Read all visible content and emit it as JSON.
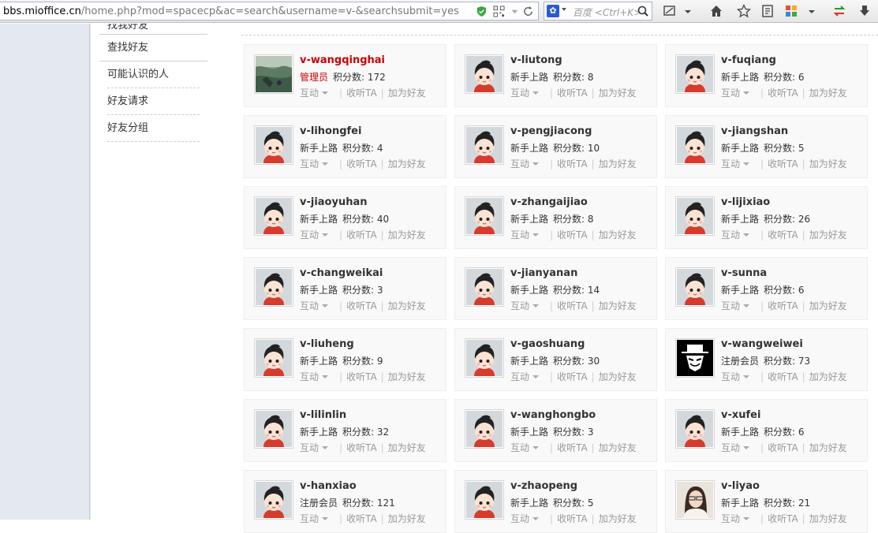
{
  "browser": {
    "url_host": "bbs.mioffice.cn",
    "url_path": "/home.php?mod=spacecp&ac=search&username=v-&searchsubmit=yes",
    "search_placeholder": "百度 <Ctrl+K>",
    "icons": [
      "shield-icon",
      "qr-icon",
      "dropdown-icon",
      "refresh-icon",
      "paw-icon",
      "search-icon",
      "screenshot-icon",
      "home-icon",
      "star-icon",
      "reader-icon",
      "apps-icon",
      "sync-icon",
      "download-icon"
    ]
  },
  "sidebar": {
    "cut_item": "找我好友",
    "active": "查找好友",
    "items": [
      "可能认识的人",
      "好友请求",
      "好友分组"
    ]
  },
  "labels": {
    "points": "积分数:",
    "interact": "互动",
    "follow": "收听TA",
    "add_friend": "加为好友"
  },
  "users": [
    {
      "name": "v-wangqinghai",
      "group": "管理员",
      "points": "172",
      "avatar": "photo-landscape",
      "admin": true
    },
    {
      "name": "v-liutong",
      "group": "新手上路",
      "points": "8",
      "avatar": "default"
    },
    {
      "name": "v-fuqiang",
      "group": "新手上路",
      "points": "6",
      "avatar": "default"
    },
    {
      "name": "v-lihongfei",
      "group": "新手上路",
      "points": "4",
      "avatar": "default"
    },
    {
      "name": "v-pengjiacong",
      "group": "新手上路",
      "points": "10",
      "avatar": "default"
    },
    {
      "name": "v-jiangshan",
      "group": "新手上路",
      "points": "5",
      "avatar": "default"
    },
    {
      "name": "v-jiaoyuhan",
      "group": "新手上路",
      "points": "40",
      "avatar": "default"
    },
    {
      "name": "v-zhangaijiao",
      "group": "新手上路",
      "points": "8",
      "avatar": "default"
    },
    {
      "name": "v-lijixiao",
      "group": "新手上路",
      "points": "26",
      "avatar": "default"
    },
    {
      "name": "v-changweikai",
      "group": "新手上路",
      "points": "3",
      "avatar": "default"
    },
    {
      "name": "v-jianyanan",
      "group": "新手上路",
      "points": "14",
      "avatar": "default"
    },
    {
      "name": "v-sunna",
      "group": "新手上路",
      "points": "6",
      "avatar": "default"
    },
    {
      "name": "v-liuheng",
      "group": "新手上路",
      "points": "9",
      "avatar": "default"
    },
    {
      "name": "v-gaoshuang",
      "group": "新手上路",
      "points": "30",
      "avatar": "default"
    },
    {
      "name": "v-wangweiwei",
      "group": "注册会员",
      "points": "73",
      "avatar": "mask"
    },
    {
      "name": "v-lilinlin",
      "group": "新手上路",
      "points": "32",
      "avatar": "default"
    },
    {
      "name": "v-wanghongbo",
      "group": "新手上路",
      "points": "3",
      "avatar": "default"
    },
    {
      "name": "v-xufei",
      "group": "新手上路",
      "points": "6",
      "avatar": "default"
    },
    {
      "name": "v-hanxiao",
      "group": "注册会员",
      "points": "121",
      "avatar": "default"
    },
    {
      "name": "v-zhaopeng",
      "group": "新手上路",
      "points": "5",
      "avatar": "default"
    },
    {
      "name": "v-liyao",
      "group": "新手上路",
      "points": "21",
      "avatar": "photo-person"
    }
  ],
  "colors": {
    "admin": "#cc0000",
    "card_bg": "#f9f9f9",
    "left_gutter": "#e4e8f1"
  }
}
